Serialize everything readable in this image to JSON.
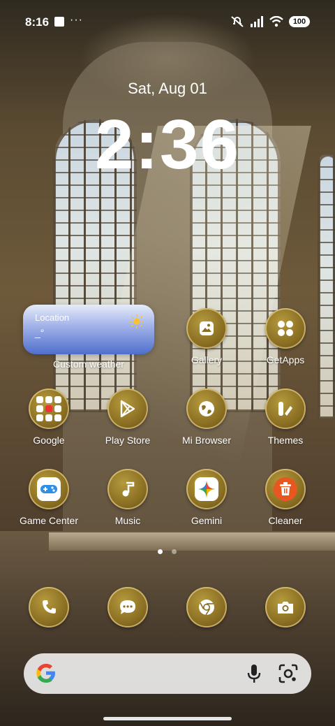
{
  "status_bar": {
    "time": "8:16",
    "more": "···",
    "battery": "100",
    "icons": [
      "notification-square-icon",
      "mute-icon",
      "signal-icon",
      "wifi-icon",
      "battery-icon"
    ]
  },
  "lockscreen": {
    "date": "Sat, Aug 01",
    "time": "2:36"
  },
  "weather_widget": {
    "location": "Location",
    "temp": "_°",
    "label": "Custom weather",
    "icon": "sun-icon"
  },
  "apps_row1": [
    {
      "label": "Gallery",
      "icon": "gallery-icon"
    },
    {
      "label": "GetApps",
      "icon": "getapps-icon"
    }
  ],
  "apps_row2": [
    {
      "label": "Google",
      "icon": "folder-icon"
    },
    {
      "label": "Play Store",
      "icon": "play-store-icon"
    },
    {
      "label": "Mi Browser",
      "icon": "globe-icon"
    },
    {
      "label": "Themes",
      "icon": "themes-icon"
    }
  ],
  "apps_row3": [
    {
      "label": "Game Center",
      "icon": "gamepad-icon"
    },
    {
      "label": "Music",
      "icon": "music-note-icon"
    },
    {
      "label": "Gemini",
      "icon": "gemini-star-icon"
    },
    {
      "label": "Cleaner",
      "icon": "trash-icon"
    }
  ],
  "dock": [
    "phone-icon",
    "messages-icon",
    "chrome-icon",
    "camera-icon"
  ],
  "page_indicator": {
    "pages": 2,
    "current": 1
  },
  "search": {
    "icons": [
      "google-g-icon",
      "microphone-icon",
      "lens-icon"
    ]
  },
  "colors": {
    "icon_gold": "#8a6e22",
    "widget_blue": "#4f6fcc",
    "cleaner_orange": "#e8571f"
  }
}
